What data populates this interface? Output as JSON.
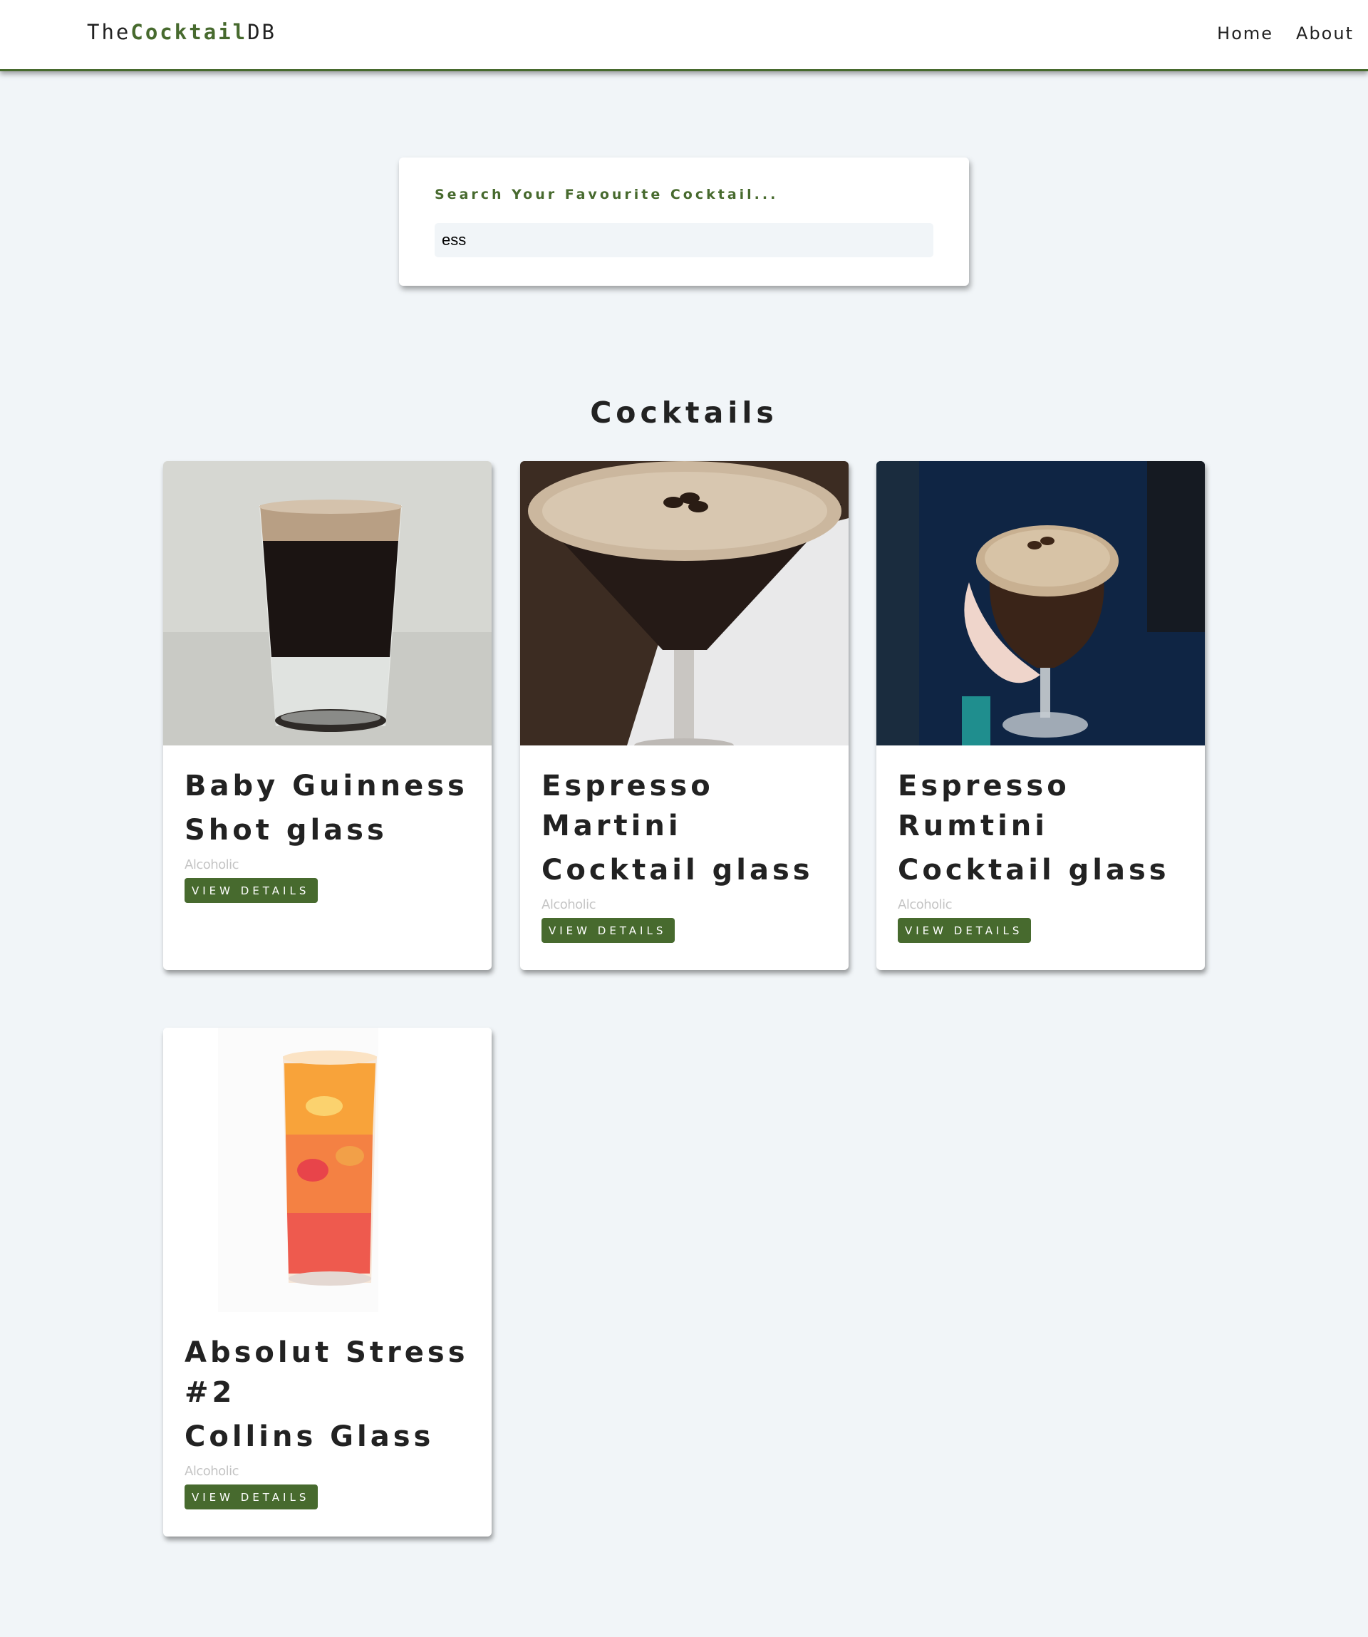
{
  "navbar": {
    "logo_prefix": "The",
    "logo_highlight": "Cocktail",
    "logo_suffix": "DB",
    "links": [
      {
        "label": "Home"
      },
      {
        "label": "About"
      }
    ],
    "accent_color": "#476a2e"
  },
  "search": {
    "label": "Search Your Favourite Cocktail...",
    "value": "ess"
  },
  "section_title": "Cocktails",
  "cocktails": [
    {
      "name": "Baby Guinness",
      "glass": "Shot glass",
      "info": "Alcoholic",
      "button_label": "VIEW DETAILS"
    },
    {
      "name": "Espresso Martini",
      "glass": "Cocktail glass",
      "info": "Alcoholic",
      "button_label": "VIEW DETAILS"
    },
    {
      "name": "Espresso Rumtini",
      "glass": "Cocktail glass",
      "info": "Alcoholic",
      "button_label": "VIEW DETAILS"
    },
    {
      "name": "Absolut Stress #2",
      "glass": "Collins Glass",
      "info": "Alcoholic",
      "button_label": "VIEW DETAILS"
    }
  ],
  "colors": {
    "page_background": "#f1f5f8",
    "button": "#476a2e",
    "text": "#222222",
    "muted": "#c4c4c4"
  }
}
